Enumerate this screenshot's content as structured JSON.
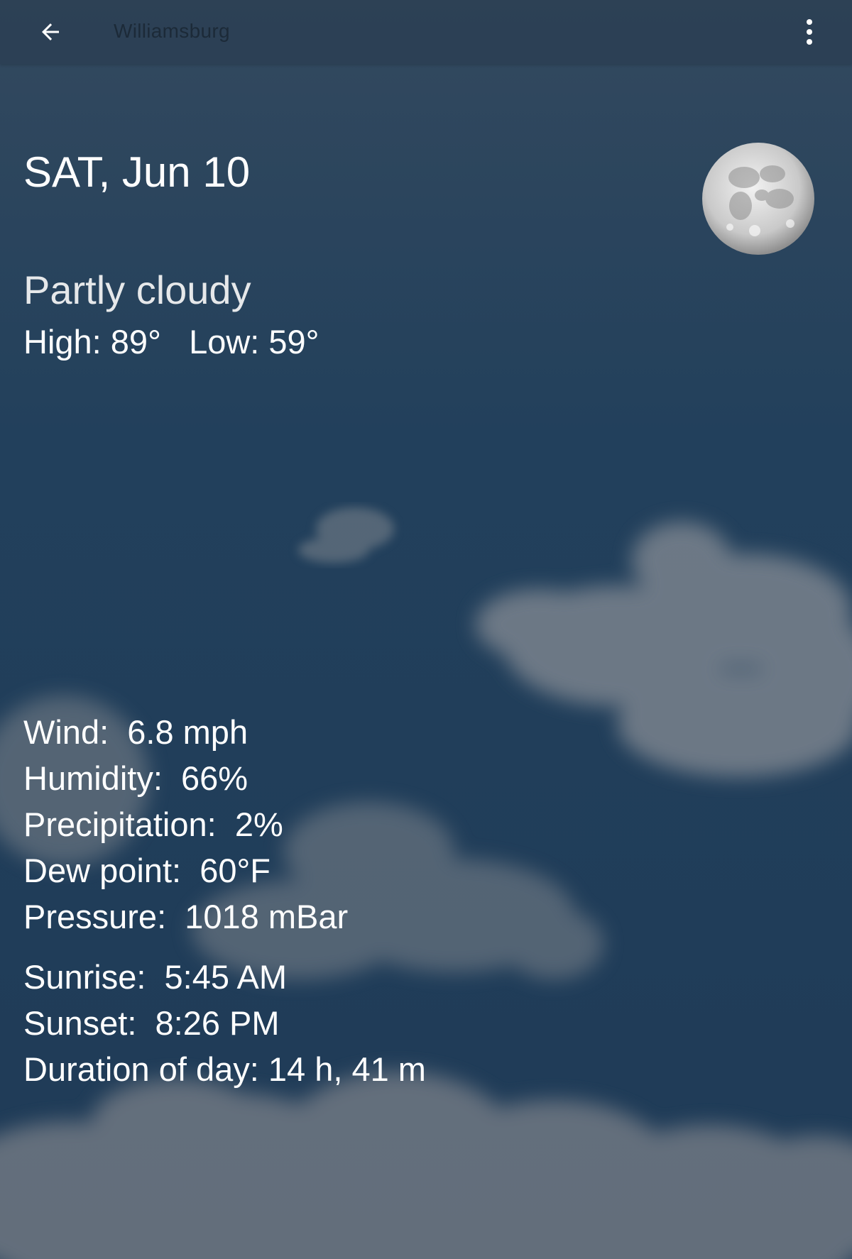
{
  "appbar": {
    "title": "Williamsburg",
    "back_icon": "arrow-left-icon",
    "menu_icon": "more-vertical-icon"
  },
  "forecast": {
    "date": "SAT, Jun 10",
    "condition": "Partly cloudy",
    "high_label": "High:",
    "high": "89°",
    "low_label": "Low:",
    "low": "59°",
    "moon_icon": "full-moon-icon"
  },
  "details": {
    "wind": {
      "label": "Wind:",
      "value": "6.8 mph"
    },
    "humidity": {
      "label": "Humidity:",
      "value": "66%"
    },
    "precipitation": {
      "label": "Precipitation:",
      "value": "2%"
    },
    "dew_point": {
      "label": "Dew point:",
      "value": "60°F"
    },
    "pressure": {
      "label": "Pressure:",
      "value": "1018 mBar"
    },
    "sunrise": {
      "label": "Sunrise:",
      "value": "5:45 AM"
    },
    "sunset": {
      "label": "Sunset:",
      "value": "8:26 PM"
    },
    "day_duration": {
      "label": "Duration of day:",
      "value": "14 h, 41 m"
    }
  },
  "colors": {
    "sky_top": "#2f475e",
    "sky_bottom": "#1f3d5b",
    "text": "#ffffff",
    "cloud": "#8a9099"
  }
}
